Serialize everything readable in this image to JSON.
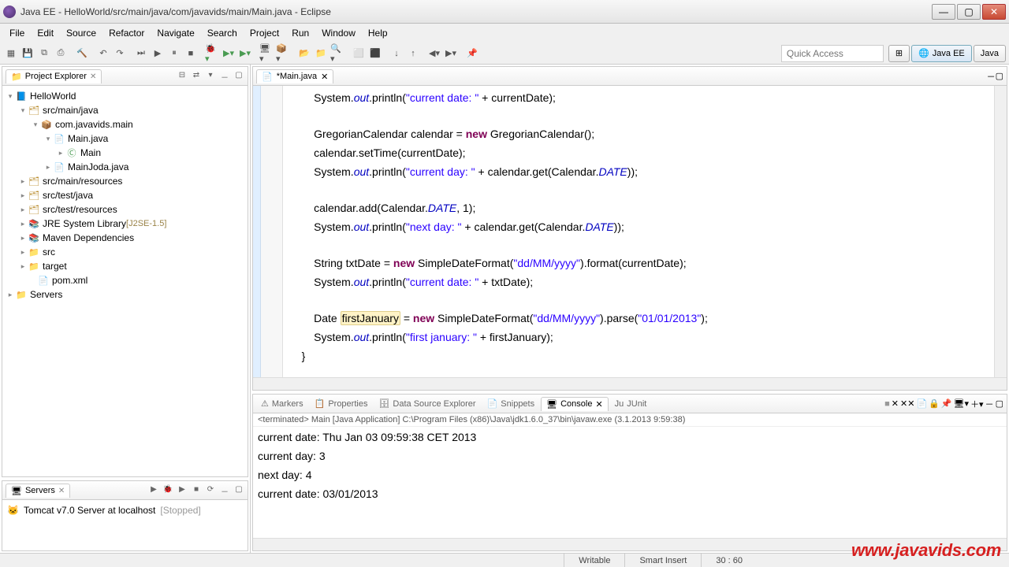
{
  "window": {
    "title": "Java EE - HelloWorld/src/main/java/com/javavids/main/Main.java - Eclipse"
  },
  "menu": [
    "File",
    "Edit",
    "Source",
    "Refactor",
    "Navigate",
    "Search",
    "Project",
    "Run",
    "Window",
    "Help"
  ],
  "quick_access_placeholder": "Quick Access",
  "perspectives": {
    "active": "Java EE",
    "other": "Java"
  },
  "project_explorer": {
    "title": "Project Explorer",
    "items": {
      "project": "HelloWorld",
      "src_main_java": "src/main/java",
      "pkg": "com.javavids.main",
      "main_java": "Main.java",
      "main_class": "Main",
      "mainjoda_java": "MainJoda.java",
      "src_main_resources": "src/main/resources",
      "src_test_java": "src/test/java",
      "src_test_resources": "src/test/resources",
      "jre": "JRE System Library",
      "jre_ver": "[J2SE-1.5]",
      "maven": "Maven Dependencies",
      "src": "src",
      "target": "target",
      "pom": "pom.xml",
      "servers": "Servers"
    }
  },
  "servers_view": {
    "title": "Servers",
    "server": "Tomcat v7.0 Server at localhost",
    "status": "[Stopped]"
  },
  "editor": {
    "tab": "*Main.java"
  },
  "code": {
    "l1a": "System.",
    "l1b": "out",
    "l1c": ".println(",
    "l1d": "\"current date: \"",
    "l1e": " + currentDate);",
    "l2a": "GregorianCalendar calendar = ",
    "l2b": "new",
    "l2c": " GregorianCalendar();",
    "l3": "calendar.setTime(currentDate);",
    "l4a": "System.",
    "l4b": "out",
    "l4c": ".println(",
    "l4d": "\"current day: \"",
    "l4e": " + calendar.get(Calendar.",
    "l4f": "DATE",
    "l4g": "));",
    "l5a": "calendar.add(Calendar.",
    "l5b": "DATE",
    "l5c": ", 1);",
    "l6a": "System.",
    "l6b": "out",
    "l6c": ".println(",
    "l6d": "\"next day: \"",
    "l6e": " + calendar.get(Calendar.",
    "l6f": "DATE",
    "l6g": "));",
    "l7a": "String txtDate = ",
    "l7b": "new",
    "l7c": " SimpleDateFormat(",
    "l7d": "\"dd/MM/yyyy\"",
    "l7e": ").format(currentDate);",
    "l8a": "System.",
    "l8b": "out",
    "l8c": ".println(",
    "l8d": "\"current date: \"",
    "l8e": " + txtDate);",
    "l9a": "Date ",
    "l9b": "firstJanuary",
    "l9c": " = ",
    "l9d": "new",
    "l9e": " SimpleDateFormat(",
    "l9f": "\"dd/MM/yyyy\"",
    "l9g": ").parse(",
    "l9h": "\"01/01/2013\"",
    "l9i": ");",
    "l10a": "System.",
    "l10b": "out",
    "l10c": ".println(",
    "l10d": "\"first january: \"",
    "l10e": " + firstJanuary);",
    "l11": "}"
  },
  "bottom_tabs": {
    "markers": "Markers",
    "properties": "Properties",
    "dse": "Data Source Explorer",
    "snippets": "Snippets",
    "console": "Console",
    "junit": "JUnit"
  },
  "console": {
    "header": "<terminated> Main [Java Application] C:\\Program Files (x86)\\Java\\jdk1.6.0_37\\bin\\javaw.exe (3.1.2013 9:59:38)",
    "o1": "current date: Thu Jan 03 09:59:38 CET 2013",
    "o2": "current day: 3",
    "o3": "next day: 4",
    "o4": "current date: 03/01/2013"
  },
  "status": {
    "writable": "Writable",
    "insert": "Smart Insert",
    "pos": "30 : 60"
  },
  "watermark": "www.javavids.com"
}
